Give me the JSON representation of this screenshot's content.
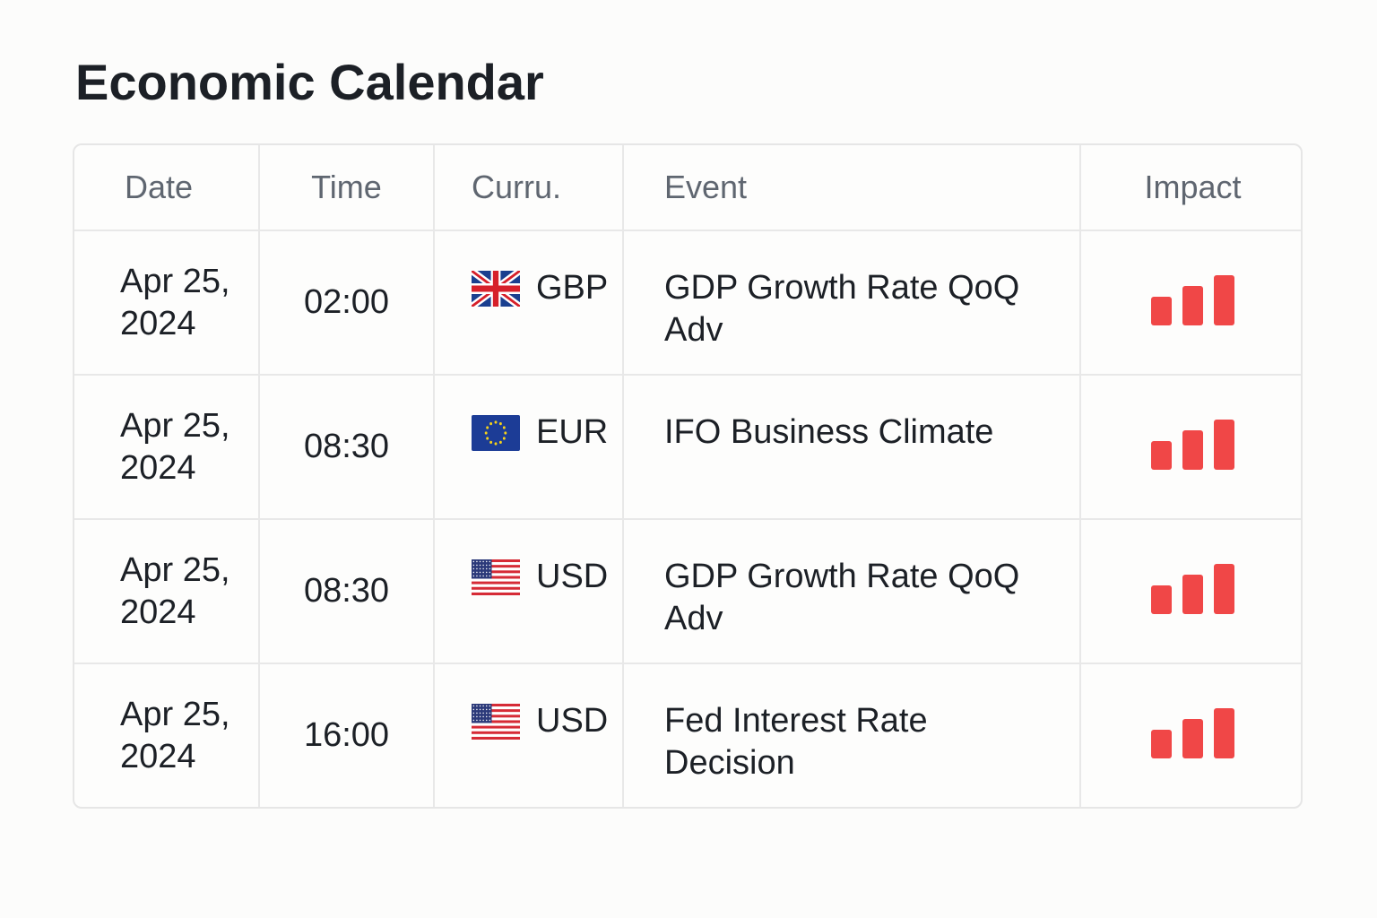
{
  "page": {
    "title": "Economic Calendar"
  },
  "table": {
    "headers": {
      "date": "Date",
      "time": "Time",
      "currency": "Curru.",
      "event": "Event",
      "impact": "Impact"
    },
    "rows": [
      {
        "date": "Apr 25, 2024",
        "time": "02:00",
        "currency": "GBP",
        "flag_icon": "uk-flag-icon",
        "event": "GDP Growth Rate QoQ Adv",
        "impact_level": 3
      },
      {
        "date": "Apr 25, 2024",
        "time": "08:30",
        "currency": "EUR",
        "flag_icon": "eu-flag-icon",
        "event": "IFO Business Climate",
        "impact_level": 3
      },
      {
        "date": "Apr 25, 2024",
        "time": "08:30",
        "currency": "USD",
        "flag_icon": "us-flag-icon",
        "event": "GDP Growth Rate QoQ Adv",
        "impact_level": 3
      },
      {
        "date": "Apr 25, 2024",
        "time": "16:00",
        "currency": "USD",
        "flag_icon": "us-flag-icon",
        "event": "Fed Interest Rate Decision",
        "impact_level": 3
      }
    ]
  },
  "colors": {
    "impact_high": "#f04747",
    "border": "#e8e8e8",
    "header_text": "#5f6670",
    "body_text": "#1c2026"
  }
}
